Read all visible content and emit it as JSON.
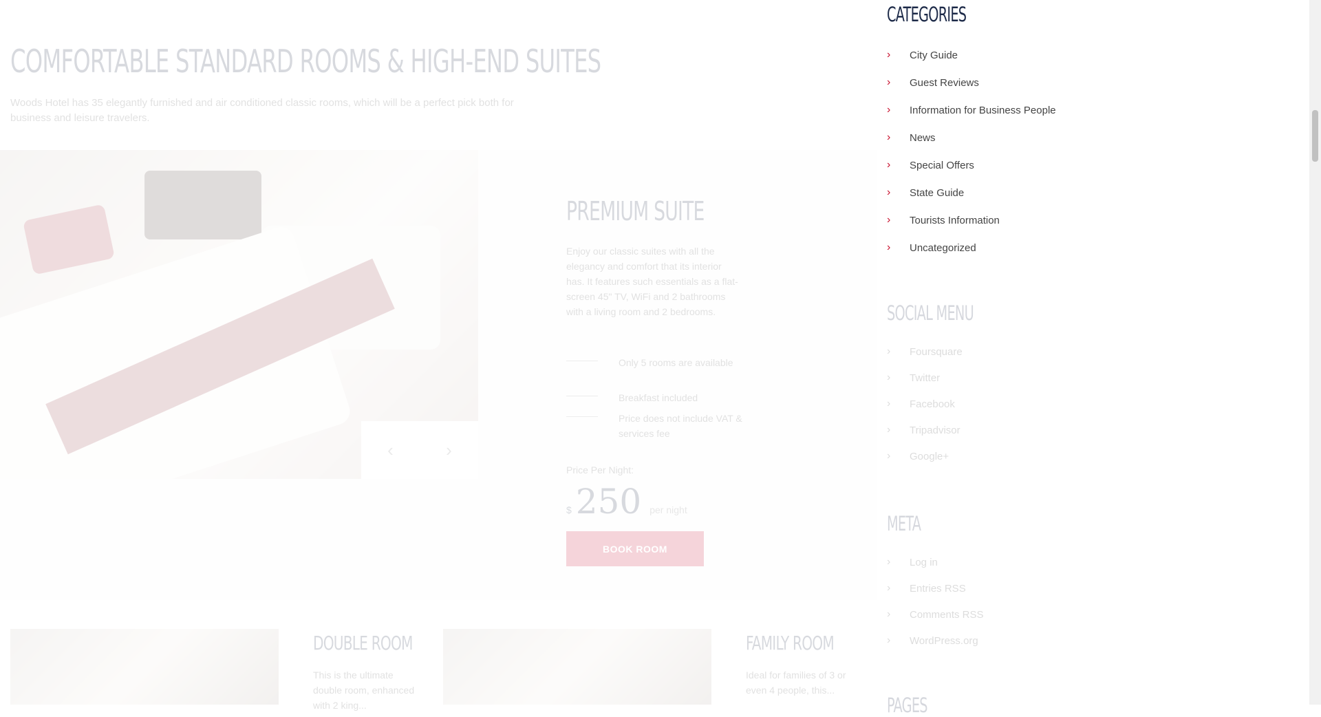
{
  "hero": {
    "title": "COMFORTABLE STANDARD ROOMS & HIGH-END SUITES",
    "description": "Woods Hotel has 35 elegantly furnished and air conditioned classic rooms, which will be a perfect pick both for business and leisure travelers."
  },
  "featured": {
    "name": "PREMIUM SUITE",
    "description": "Enjoy our classic suites with all the elegancy and comfort that its interior has.   It features such essentials as a flat-screen 45\" TV, WiFi and 2 bathrooms with a living room and 2 bedrooms.",
    "features": [
      "Only 5 rooms are available",
      "Breakfast included",
      "Price does not include VAT & services fee"
    ],
    "price_label": "Price Per Night:",
    "currency": "$",
    "price": "250",
    "per": "per night",
    "book_label": "BOOK ROOM",
    "prev_icon": "chevron-left-icon",
    "next_icon": "chevron-right-icon"
  },
  "cards": [
    {
      "title": "DOUBLE ROOM",
      "description": "This is the ultimate double room, enhanced with 2 king..."
    },
    {
      "title": "FAMILY ROOM",
      "description": "Ideal for families of 3 or even 4 people, this..."
    }
  ],
  "sidebar": {
    "categories_title": "CATEGORIES",
    "categories": [
      "City Guide",
      "Guest Reviews",
      "Information for Business People",
      "News",
      "Special Offers",
      "State Guide",
      "Tourists Information",
      "Uncategorized"
    ],
    "social_title": "SOCIAL MENU",
    "social": [
      "Foursquare",
      "Twitter",
      "Facebook",
      "Tripadvisor",
      "Google+"
    ],
    "meta_title": "META",
    "meta": [
      "Log in",
      "Entries RSS",
      "Comments RSS",
      "WordPress.org"
    ],
    "pages_title": "PAGES"
  },
  "colors": {
    "accent": "#c8102e",
    "heading": "#1d2a48"
  }
}
